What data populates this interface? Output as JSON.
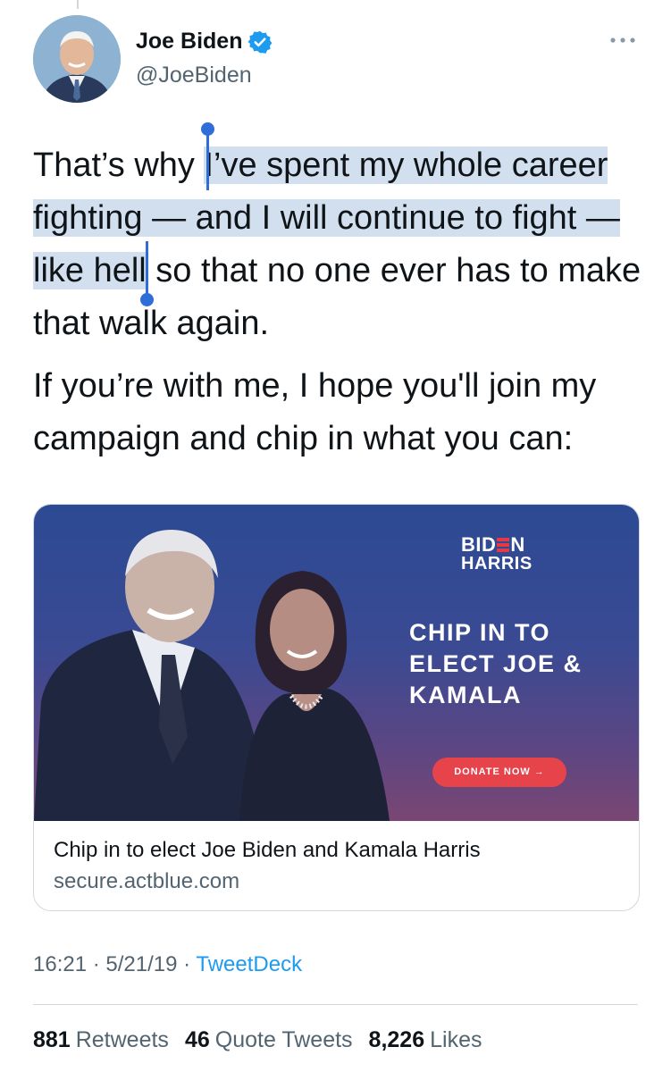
{
  "author": {
    "name": "Joe Biden",
    "handle": "@JoeBiden"
  },
  "icons": {
    "verified": "verified-badge-icon",
    "more": "more-options-icon"
  },
  "tweet": {
    "para1": {
      "before": "That’s why ",
      "selected": "I’ve spent my whole career fighting — and I will continue to fight — like hell",
      "after": " so that no one ever has to make that walk again."
    },
    "para2": "If you’re with me, I hope you'll join my campaign and chip in what you can:"
  },
  "card": {
    "logo_line1_a": "BID",
    "logo_line1_b": "N",
    "logo_line2": "HARRIS",
    "headline": "CHIP IN TO ELECT JOE & KAMALA",
    "donate_label": "DONATE NOW →",
    "title": "Chip in to elect Joe Biden and Kamala Harris",
    "domain": "secure.actblue.com"
  },
  "meta": {
    "time": "16:21",
    "date": "5/21/19",
    "source": "TweetDeck",
    "separator": " · "
  },
  "stats": {
    "retweets_count": "881",
    "retweets_label": "Retweets",
    "quotes_count": "46",
    "quotes_label": "Quote Tweets",
    "likes_count": "8,226",
    "likes_label": "Likes"
  },
  "colors": {
    "link_blue": "#1d9bf0",
    "selection": "#d2dfee",
    "selection_handle": "#2f6ed8",
    "donate_red": "#e6434b",
    "card_bg": "#2c4a93"
  }
}
